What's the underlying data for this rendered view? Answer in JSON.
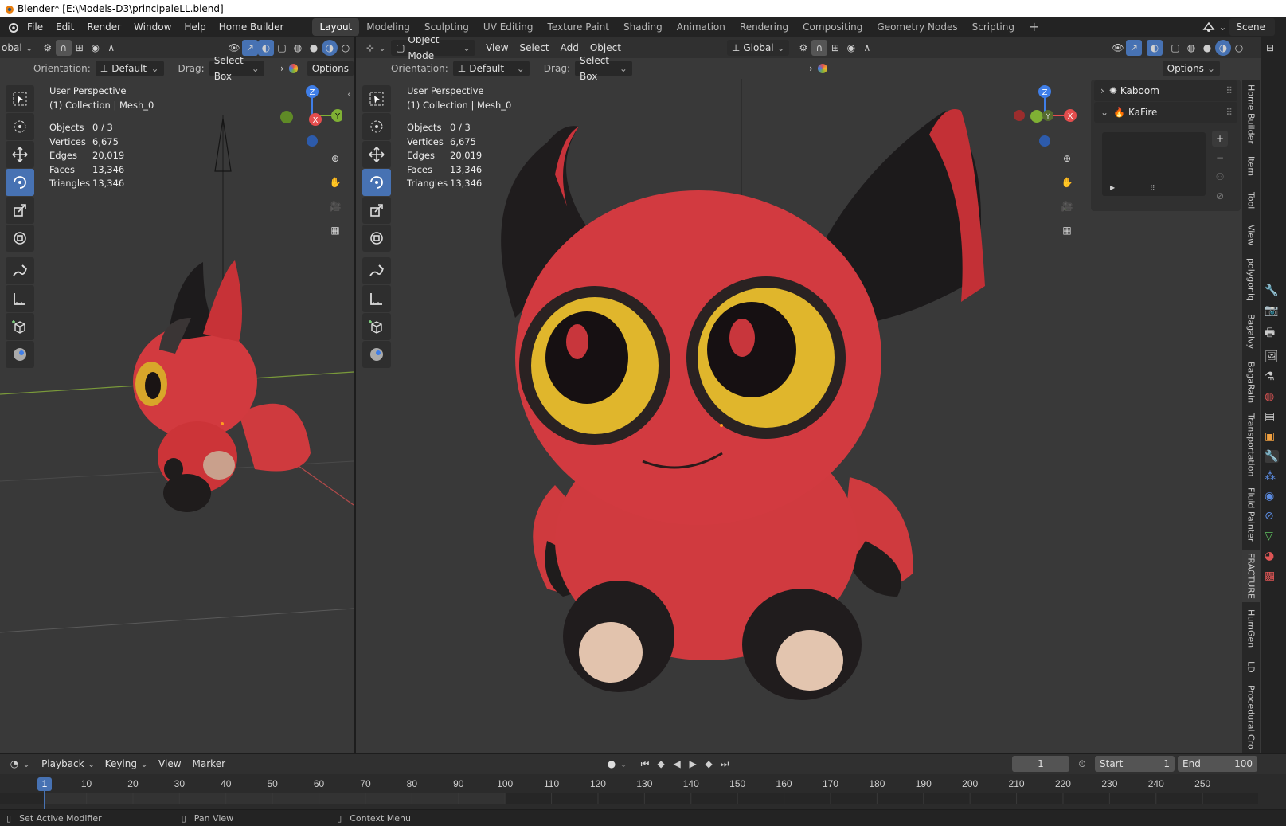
{
  "window": {
    "title": "Blender* [E:\\Models-D3\\principaleLL.blend]"
  },
  "menu": [
    "File",
    "Edit",
    "Render",
    "Window",
    "Help",
    "Home Builder"
  ],
  "workspaces": [
    "Layout",
    "Modeling",
    "Sculpting",
    "UV Editing",
    "Texture Paint",
    "Shading",
    "Animation",
    "Rendering",
    "Compositing",
    "Geometry Nodes",
    "Scripting"
  ],
  "active_workspace": "Layout",
  "scene_name": "Scene",
  "left_viewport": {
    "header_partial": "obal",
    "orientation_label": "Orientation:",
    "orientation_value": "Default",
    "drag_label": "Drag:",
    "drag_value": "Select Box",
    "options_label": "Options",
    "view_name": "User Perspective",
    "collection": "(1) Collection | Mesh_0",
    "stats": [
      {
        "k": "Objects",
        "v": "0 / 3"
      },
      {
        "k": "Vertices",
        "v": "6,675"
      },
      {
        "k": "Edges",
        "v": "20,019"
      },
      {
        "k": "Faces",
        "v": "13,346"
      },
      {
        "k": "Triangles",
        "v": "13,346"
      }
    ]
  },
  "right_viewport": {
    "mode": "Object Mode",
    "header_menu": [
      "View",
      "Select",
      "Add",
      "Object"
    ],
    "transform": "Global",
    "orientation_label": "Orientation:",
    "orientation_value": "Default",
    "drag_label": "Drag:",
    "drag_value": "Select Box",
    "options_label": "Options",
    "view_name": "User Perspective",
    "collection": "(1) Collection | Mesh_0",
    "stats": [
      {
        "k": "Objects",
        "v": "0 / 3"
      },
      {
        "k": "Vertices",
        "v": "6,675"
      },
      {
        "k": "Edges",
        "v": "20,019"
      },
      {
        "k": "Faces",
        "v": "13,346"
      },
      {
        "k": "Triangles",
        "v": "13,346"
      }
    ]
  },
  "gizmo_axes": {
    "z": "Z",
    "y": "Y",
    "x": "X"
  },
  "npanel": {
    "panels": [
      "Kaboom",
      "KaFire"
    ]
  },
  "side_tabs": [
    "Home Builder",
    "Item",
    "Tool",
    "View",
    "polygoniq",
    "Bagalvy",
    "BagaRain",
    "Transportation",
    "Fluid Painter",
    "FRACTURE",
    "HumGen",
    "LD",
    "Procedural Cro"
  ],
  "timeline": {
    "menus": [
      "Playback",
      "Keying",
      "View",
      "Marker"
    ],
    "current_frame": "1",
    "start_label": "Start",
    "start": "1",
    "end_label": "End",
    "end": "100",
    "ticks": [
      "1",
      "10",
      "20",
      "30",
      "40",
      "50",
      "60",
      "70",
      "80",
      "90",
      "100",
      "110",
      "120",
      "130",
      "140",
      "150",
      "160",
      "170",
      "180",
      "190",
      "200",
      "210",
      "220",
      "230",
      "240",
      "250"
    ]
  },
  "status": [
    "Set Active Modifier",
    "Pan View",
    "Context Menu"
  ],
  "colors": {
    "accent": "#4772b3",
    "axis_x": "#e44d4d",
    "axis_y": "#7fb034",
    "axis_z": "#3f7ee8"
  }
}
